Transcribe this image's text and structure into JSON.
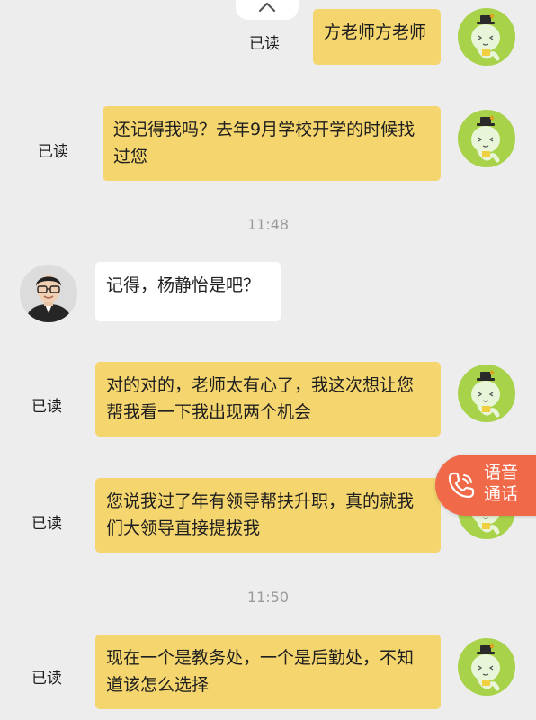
{
  "messages": [
    {
      "id": "m1",
      "text": "方老师方老师",
      "read": "已读"
    },
    {
      "id": "m2",
      "text": "还记得我吗？去年9月学校开学的时候找过您",
      "read": "已读"
    },
    {
      "id": "m3",
      "text": "记得，杨静怡是吧？"
    },
    {
      "id": "m4",
      "text": "对的对的，老师太有心了，我这次想让您帮我看一下我出现两个机会",
      "read": "已读"
    },
    {
      "id": "m5",
      "text": "您说我过了年有领导帮扶升职，真的就我们大领导直接提拔我",
      "read": "已读"
    },
    {
      "id": "m6",
      "text": "现在一个是教务处，一个是后勤处，不知道该怎么选择",
      "read": "已读"
    }
  ],
  "timestamps": [
    "11:48",
    "11:50"
  ],
  "voice_call": {
    "line1": "语音",
    "line2": "通话",
    "icon": "phone-icon"
  },
  "collapse": {
    "icon": "chevron-up-icon"
  },
  "colors": {
    "my_bubble": "#f4d56e",
    "their_bubble": "#ffffff",
    "background": "#ededed",
    "voice_call": "#f06a4a",
    "avatar_green": "#a8d24a"
  }
}
